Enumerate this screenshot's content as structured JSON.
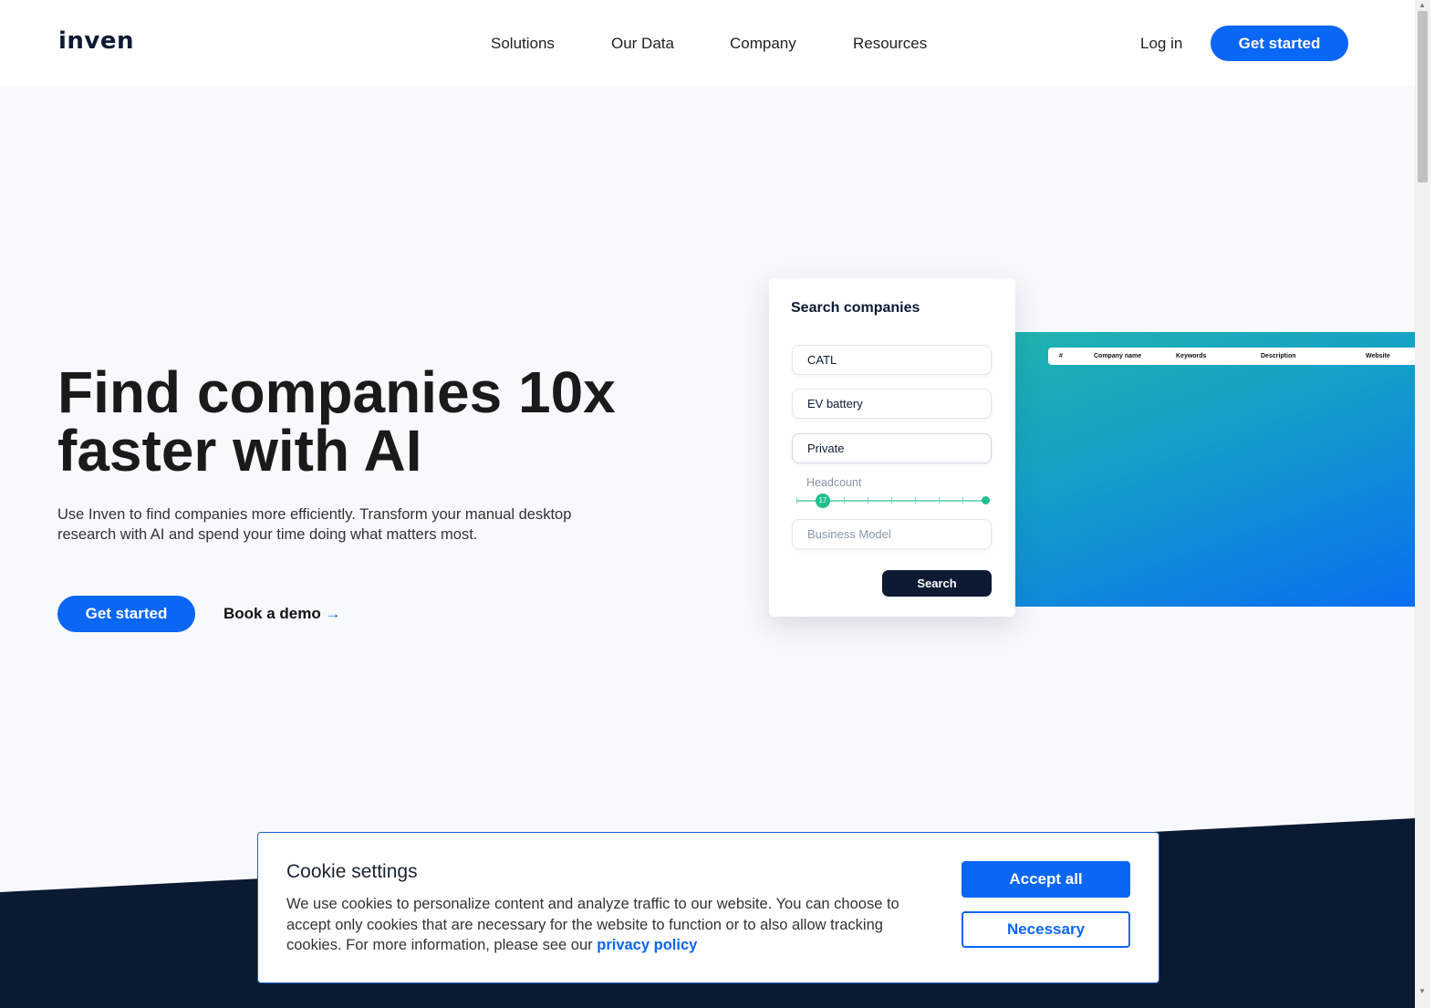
{
  "nav": {
    "logo": "inven",
    "links": [
      "Solutions",
      "Our Data",
      "Company",
      "Resources"
    ],
    "login": "Log in",
    "get_started": "Get started"
  },
  "hero": {
    "title": "Find companies 10x faster with AI",
    "subtitle": "Use Inven to find companies more efficiently. Transform your manual desktop research with AI and spend your time doing what matters most.",
    "get_started": "Get started",
    "book_demo": "Book a demo",
    "book_demo_icon": "arrow-right-icon"
  },
  "search_card": {
    "title": "Search companies",
    "fields": [
      "CATL",
      "EV battery",
      "Private"
    ],
    "headcount_label": "Headcount",
    "headcount_value": "17",
    "business_model_placeholder": "Business Model",
    "search_button": "Search"
  },
  "results_table": {
    "columns": [
      "#",
      "Company name",
      "Keywords",
      "Description",
      "Website"
    ]
  },
  "cookie": {
    "title": "Cookie settings",
    "text": "We use cookies to personalize content and analyze traffic to our website. You can choose to accept only cookies that are necessary for the website to function or to also allow tracking cookies. For more information, please see our ",
    "link": "privacy policy",
    "accept_all": "Accept all",
    "necessary": "Necessary"
  },
  "colors": {
    "brand": "#0a66f5",
    "dark": "#0b1a33",
    "accent_green": "#21c08e"
  }
}
